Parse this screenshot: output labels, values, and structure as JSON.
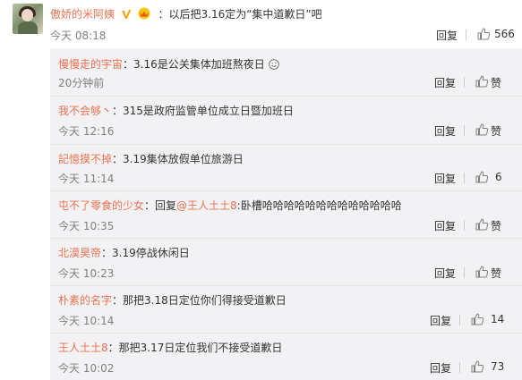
{
  "main": {
    "username": "傲娇的米阿姨",
    "text": "：以后把3.16定为“集中道歉日”吧",
    "time": "今天 08:18",
    "reply_label": "回复",
    "likes": "566"
  },
  "replies": [
    {
      "user": "慢慢走的宇宙",
      "text": "：3.16是公关集体加班熬夜日",
      "time": "20分钟前",
      "reply_label": "回复",
      "like_label": "赞",
      "has_emoji": true
    },
    {
      "user": "我不会够丶",
      "text": "：315是政府监管单位成立日暨加班日",
      "time": "今天 12:16",
      "reply_label": "回复",
      "like_label": "赞"
    },
    {
      "user": "記憶摸不掉",
      "text": "：3.19集体放假单位旅游日",
      "time": "今天 11:14",
      "reply_label": "回复",
      "likes": "6"
    },
    {
      "user": "屯不了零食的少女",
      "text_prefix": "：回复",
      "at": "@王人土土8",
      "text": ":卧槽哈哈哈哈哈哈哈哈哈哈哈哈哈",
      "time": "今天 10:35",
      "reply_label": "回复",
      "like_label": "赞"
    },
    {
      "user": "北漠昊帝",
      "text": "：3.19停战休闲日",
      "time": "今天 10:23",
      "reply_label": "回复",
      "like_label": "赞"
    },
    {
      "user": "朴素的名字",
      "text": "：那把3.18日定位你们得接受道歉日",
      "time": "今天 10:14",
      "reply_label": "回复",
      "likes": "14"
    },
    {
      "user": "王人土土8",
      "text": "：那把3.17日定位我们不接受道歉日",
      "time": "今天 10:02",
      "reply_label": "回复",
      "likes": "73"
    }
  ],
  "colors": {
    "username": "#eb7350",
    "time": "#808080",
    "panel": "#f2f2f5"
  }
}
